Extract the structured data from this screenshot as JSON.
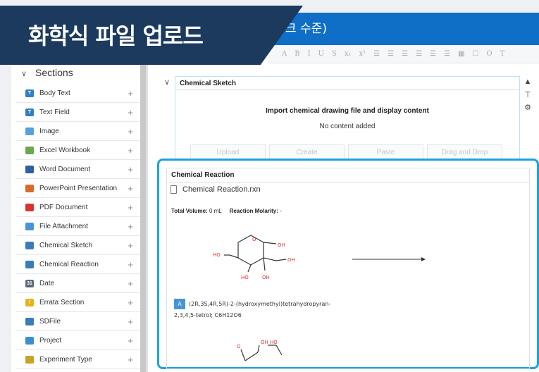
{
  "banner": {
    "title": "화학식 파일 업로드"
  },
  "app": {
    "title_partial": "크 수준)"
  },
  "toolbar": {
    "glyphs": [
      "A",
      "B",
      "I",
      "U",
      "S",
      "x₁",
      "x¹",
      "☰",
      "☰",
      "☰",
      "☰",
      "☰",
      "☰",
      "▦",
      "☐",
      "O",
      "T"
    ]
  },
  "sidebar": {
    "heading": "Sections",
    "items": [
      {
        "label": "Body Text",
        "color": "#2f7fc4",
        "glyph": "T",
        "icon": "text-icon"
      },
      {
        "label": "Text Field",
        "color": "#2f7fc4",
        "glyph": "T",
        "icon": "text-field-icon"
      },
      {
        "label": "Image",
        "color": "#57a0d9",
        "glyph": "",
        "icon": "image-icon"
      },
      {
        "label": "Excel Workbook",
        "color": "#6aa84f",
        "glyph": "",
        "icon": "excel-icon"
      },
      {
        "label": "Word Document",
        "color": "#2f5f9e",
        "glyph": "",
        "icon": "word-icon"
      },
      {
        "label": "PowerPoint Presentation",
        "color": "#d86a2b",
        "glyph": "",
        "icon": "powerpoint-icon"
      },
      {
        "label": "PDF Document",
        "color": "#d9342b",
        "glyph": "",
        "icon": "pdf-icon"
      },
      {
        "label": "File Attachment",
        "color": "#4b93d8",
        "glyph": "",
        "icon": "file-attachment-icon"
      },
      {
        "label": "Chemical Sketch",
        "color": "#3a7cb8",
        "glyph": "",
        "icon": "chemical-sketch-icon"
      },
      {
        "label": "Chemical Reaction",
        "color": "#3a7cb8",
        "glyph": "",
        "icon": "chemical-reaction-icon"
      },
      {
        "label": "Date",
        "color": "#5b6b7c",
        "glyph": "31",
        "icon": "calendar-icon"
      },
      {
        "label": "Errata Section",
        "color": "#e8b21e",
        "glyph": "!",
        "icon": "warning-icon"
      },
      {
        "label": "SDFile",
        "color": "#3a7cb8",
        "glyph": "",
        "icon": "sdfile-icon"
      },
      {
        "label": "Project",
        "color": "#3b8fd0",
        "glyph": "",
        "icon": "folder-icon"
      },
      {
        "label": "Experiment Type",
        "color": "#c9a227",
        "glyph": "",
        "icon": "tag-icon"
      }
    ]
  },
  "sketch": {
    "title": "Chemical Sketch",
    "import_text": "Import chemical drawing file and display content",
    "empty_text": "No content added",
    "buttons": [
      "Upload",
      "Create",
      "Paste",
      "Drag and Drop"
    ]
  },
  "reaction": {
    "title": "Chemical Reaction",
    "file_name": "Chemical Reaction.rxn",
    "total_volume_label": "Total Volume:",
    "total_volume_value": "0 mL",
    "molarity_label": "Reaction Molarity:",
    "molarity_value": "-",
    "reactant_badge": "A",
    "reactant_name_line1": "(2R,3S,4R,5R)-2-(hydroxymethyl)tetrahydropyran-",
    "reactant_name_line2": "2,3,4,5-tetrol; C6H12O6",
    "atom_labels": {
      "ho_left": "HO",
      "oh_right": "OH",
      "oh_chain": "OH",
      "ho_bottom": "HO",
      "oh_bottom": "OH",
      "oh_top2": "OH HO",
      "o_top2": "O"
    }
  }
}
